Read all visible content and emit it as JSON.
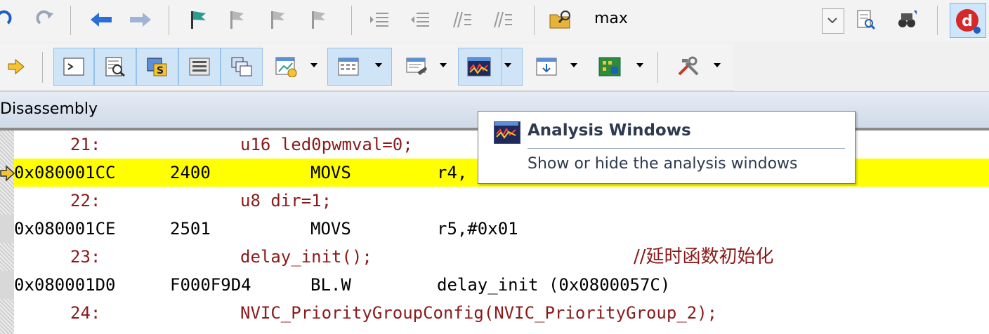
{
  "toolbar1": {
    "find_dropdown_value": "max"
  },
  "toolbar2": {
    "buttons": [
      "command-window",
      "disassembly-window",
      "symbols-window",
      "registers-window",
      "call-stack-window",
      "watch-windows",
      "memory-windows",
      "serial-windows",
      "analysis-windows",
      "trace-windows",
      "system-viewer",
      "toolbox"
    ]
  },
  "window": {
    "title": "Disassembly"
  },
  "disassembly": {
    "lines": [
      {
        "kind": "src",
        "lineno": "21:",
        "code": "u16 led0pwmval=0;",
        "comment": ""
      },
      {
        "kind": "asm",
        "addr": "0x080001CC",
        "opcode": "2400",
        "mnemonic": "MOVS",
        "operands": "r4,",
        "current": true
      },
      {
        "kind": "src",
        "lineno": "22:",
        "code": "u8 dir=1;",
        "comment": ""
      },
      {
        "kind": "asm",
        "addr": "0x080001CE",
        "opcode": "2501",
        "mnemonic": "MOVS",
        "operands": "r5,#0x01",
        "current": false
      },
      {
        "kind": "src",
        "lineno": "23:",
        "code": "delay_init();",
        "comment": "//延时函数初始化"
      },
      {
        "kind": "asm",
        "addr": "0x080001D0",
        "opcode": "F000F9D4",
        "mnemonic": "BL.W",
        "operands": "delay_init (0x0800057C)",
        "current": false
      },
      {
        "kind": "src",
        "lineno": "24:",
        "code": "NVIC_PriorityGroupConfig(NVIC_PriorityGroup_2);",
        "comment": ""
      }
    ]
  },
  "tooltip": {
    "title": "Analysis Windows",
    "description": "Show or hide the analysis windows"
  },
  "colors": {
    "highlight": "#ffff00",
    "source_text": "#8b1a1a",
    "asm_text": "#000000"
  }
}
